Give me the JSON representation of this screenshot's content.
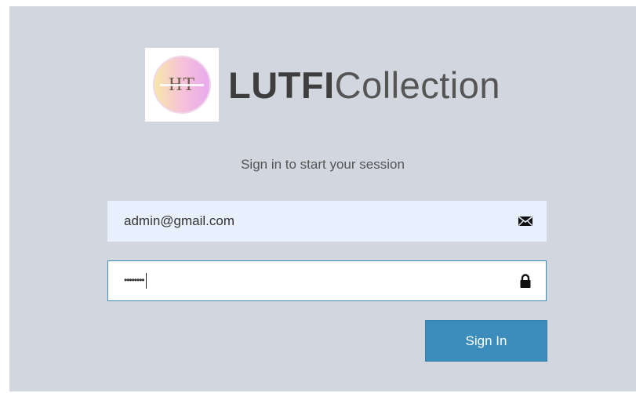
{
  "brand": {
    "logo_alt": "HT",
    "name_bold": "LUTFI",
    "name_light": "Collection"
  },
  "subtitle": "Sign in to start your session",
  "form": {
    "email_value": "admin@gmail.com",
    "password_value": "••••••••",
    "signin_label": "Sign In"
  },
  "icons": {
    "email": "envelope-icon",
    "password": "lock-icon"
  },
  "colors": {
    "background": "#d2d6de",
    "primary": "#3c8dbc",
    "autofill": "#e8f0fe"
  }
}
